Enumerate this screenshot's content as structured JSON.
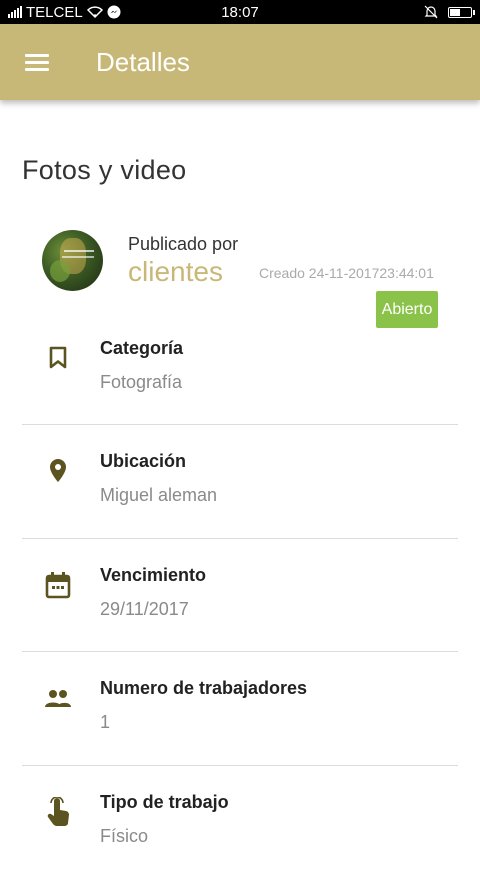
{
  "status_bar": {
    "carrier": "TELCEL",
    "time": "18:07",
    "battery_level": 0.45
  },
  "app_bar": {
    "title": "Detalles",
    "menu_icon": "hamburger-menu-icon"
  },
  "section_title": "Fotos y video",
  "publisher": {
    "label": "Publicado por",
    "name": "clientes",
    "created": "Creado 24-11-201723:44:01"
  },
  "status_badge": "Abierto",
  "colors": {
    "accent": "#c8b877",
    "badge": "#8bc34a",
    "icon": "#5b5420"
  },
  "details": [
    {
      "icon": "bookmark-icon",
      "label": "Categoría",
      "value": "Fotografía"
    },
    {
      "icon": "location-pin-icon",
      "label": "Ubicación",
      "value": "Miguel aleman"
    },
    {
      "icon": "calendar-icon",
      "label": "Vencimiento",
      "value": "29/11/2017"
    },
    {
      "icon": "people-icon",
      "label": "Numero de trabajadores",
      "value": "1"
    },
    {
      "icon": "touch-hand-icon",
      "label": "Tipo de trabajo",
      "value": "Físico"
    }
  ]
}
